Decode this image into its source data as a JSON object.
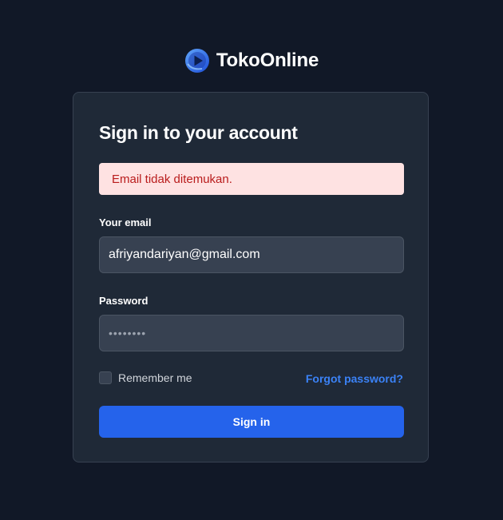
{
  "brand": {
    "name": "TokoOnline",
    "logo_icon": "play-circle-logo-icon"
  },
  "login": {
    "title": "Sign in to your account",
    "error_message": "Email tidak ditemukan.",
    "email_label": "Your email",
    "email_value": "afriyandariyan@gmail.com",
    "password_label": "Password",
    "password_value": "••••••••",
    "remember_label": "Remember me",
    "remember_checked": false,
    "forgot_label": "Forgot password?",
    "submit_label": "Sign in"
  },
  "colors": {
    "page_background": "#111827",
    "card_background": "#1f2937",
    "input_background": "#374151",
    "alert_background": "#fee2e2",
    "alert_text": "#b91c1c",
    "accent": "#2563eb",
    "link": "#3b82f6"
  }
}
